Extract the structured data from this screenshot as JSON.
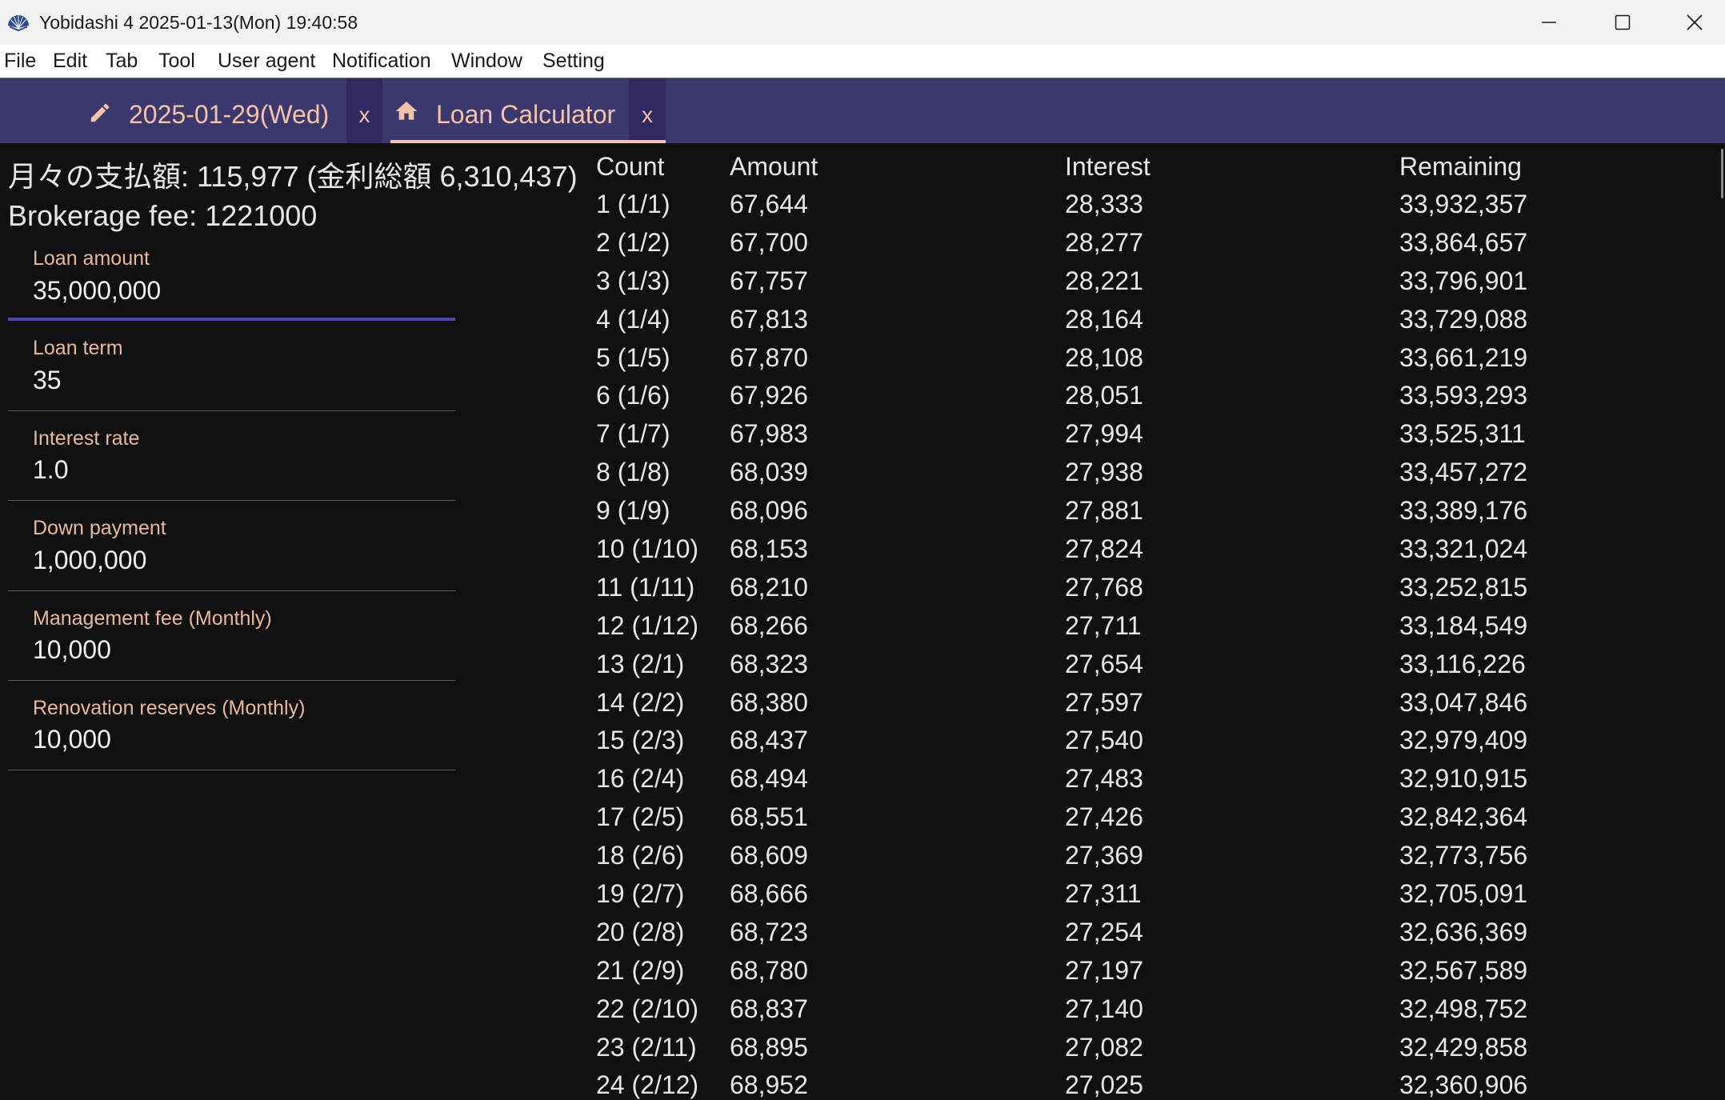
{
  "window": {
    "title": "Yobidashi 4 2025-01-13(Mon) 19:40:58",
    "icon": "fan-icon",
    "controls": {
      "minimize": "minimize-icon",
      "maximize": "maximize-icon",
      "close": "close-icon"
    }
  },
  "menu": {
    "items": [
      "File",
      "Edit",
      "Tab",
      "Tool",
      "User agent",
      "Notification",
      "Window",
      "Setting"
    ]
  },
  "tabs": [
    {
      "icon": "pencil-icon",
      "label": "2025-01-29(Wed)",
      "close": "x",
      "active": false
    },
    {
      "icon": "home-icon",
      "label": "Loan Calculator",
      "close": "x",
      "active": true
    }
  ],
  "summary": {
    "monthly_payment": "月々の支払額: 115,977 (金利総額 6,310,437)",
    "brokerage_fee": "Brokerage fee: 1221000"
  },
  "form": {
    "fields": [
      {
        "label": "Loan amount",
        "value": "35,000,000",
        "focused": true
      },
      {
        "label": "Loan term",
        "value": "35",
        "focused": false
      },
      {
        "label": "Interest rate",
        "value": "1.0",
        "focused": false
      },
      {
        "label": "Down payment",
        "value": "1,000,000",
        "focused": false
      },
      {
        "label": "Management fee (Monthly)",
        "value": "10,000",
        "focused": false
      },
      {
        "label": "Renovation reserves (Monthly)",
        "value": "10,000",
        "focused": false
      }
    ]
  },
  "table": {
    "headers": {
      "count": "Count",
      "amount": "Amount",
      "interest": "Interest",
      "remaining": "Remaining"
    },
    "rows": [
      {
        "count": "1 (1/1)",
        "amount": "67,644",
        "interest": "28,333",
        "remaining": "33,932,357"
      },
      {
        "count": "2 (1/2)",
        "amount": "67,700",
        "interest": "28,277",
        "remaining": "33,864,657"
      },
      {
        "count": "3 (1/3)",
        "amount": "67,757",
        "interest": "28,221",
        "remaining": "33,796,901"
      },
      {
        "count": "4 (1/4)",
        "amount": "67,813",
        "interest": "28,164",
        "remaining": "33,729,088"
      },
      {
        "count": "5 (1/5)",
        "amount": "67,870",
        "interest": "28,108",
        "remaining": "33,661,219"
      },
      {
        "count": "6 (1/6)",
        "amount": "67,926",
        "interest": "28,051",
        "remaining": "33,593,293"
      },
      {
        "count": "7 (1/7)",
        "amount": "67,983",
        "interest": "27,994",
        "remaining": "33,525,311"
      },
      {
        "count": "8 (1/8)",
        "amount": "68,039",
        "interest": "27,938",
        "remaining": "33,457,272"
      },
      {
        "count": "9 (1/9)",
        "amount": "68,096",
        "interest": "27,881",
        "remaining": "33,389,176"
      },
      {
        "count": "10 (1/10)",
        "amount": "68,153",
        "interest": "27,824",
        "remaining": "33,321,024"
      },
      {
        "count": "11 (1/11)",
        "amount": "68,210",
        "interest": "27,768",
        "remaining": "33,252,815"
      },
      {
        "count": "12 (1/12)",
        "amount": "68,266",
        "interest": "27,711",
        "remaining": "33,184,549"
      },
      {
        "count": "13 (2/1)",
        "amount": "68,323",
        "interest": "27,654",
        "remaining": "33,116,226"
      },
      {
        "count": "14 (2/2)",
        "amount": "68,380",
        "interest": "27,597",
        "remaining": "33,047,846"
      },
      {
        "count": "15 (2/3)",
        "amount": "68,437",
        "interest": "27,540",
        "remaining": "32,979,409"
      },
      {
        "count": "16 (2/4)",
        "amount": "68,494",
        "interest": "27,483",
        "remaining": "32,910,915"
      },
      {
        "count": "17 (2/5)",
        "amount": "68,551",
        "interest": "27,426",
        "remaining": "32,842,364"
      },
      {
        "count": "18 (2/6)",
        "amount": "68,609",
        "interest": "27,369",
        "remaining": "32,773,756"
      },
      {
        "count": "19 (2/7)",
        "amount": "68,666",
        "interest": "27,311",
        "remaining": "32,705,091"
      },
      {
        "count": "20 (2/8)",
        "amount": "68,723",
        "interest": "27,254",
        "remaining": "32,636,369"
      },
      {
        "count": "21 (2/9)",
        "amount": "68,780",
        "interest": "27,197",
        "remaining": "32,567,589"
      },
      {
        "count": "22 (2/10)",
        "amount": "68,837",
        "interest": "27,140",
        "remaining": "32,498,752"
      },
      {
        "count": "23 (2/11)",
        "amount": "68,895",
        "interest": "27,082",
        "remaining": "32,429,858"
      },
      {
        "count": "24 (2/12)",
        "amount": "68,952",
        "interest": "27,025",
        "remaining": "32,360,906"
      }
    ]
  },
  "colors": {
    "titlebar_bg": "#f3f3f3",
    "menubar_bg": "#ffffff",
    "tab_bar_bg": "#3b376f",
    "tab_close_bg": "#2f2b62",
    "tab_text": "#f3c3a6",
    "field_label": "#e8b899",
    "focus_underline": "#4b47a6",
    "content_bg": "#101010",
    "content_text": "#e6e6e6"
  }
}
